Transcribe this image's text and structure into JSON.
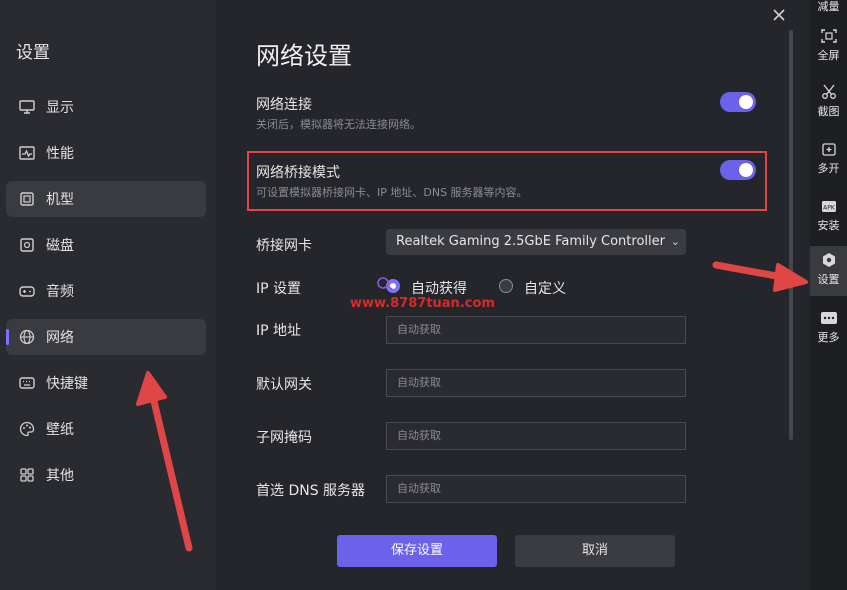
{
  "sidebar": {
    "title": "设置",
    "items": [
      {
        "label": "显示",
        "icon": "monitor-icon"
      },
      {
        "label": "性能",
        "icon": "pulse-icon"
      },
      {
        "label": "机型",
        "icon": "device-icon"
      },
      {
        "label": "磁盘",
        "icon": "disk-icon"
      },
      {
        "label": "音频",
        "icon": "gamepad-icon"
      },
      {
        "label": "网络",
        "icon": "globe-icon"
      },
      {
        "label": "快捷键",
        "icon": "keyboard-icon"
      },
      {
        "label": "壁纸",
        "icon": "palette-icon"
      },
      {
        "label": "其他",
        "icon": "grid-icon"
      }
    ]
  },
  "main": {
    "title": "网络设置",
    "network_connection": {
      "label": "网络连接",
      "desc": "关闭后，模拟器将无法连接网络。",
      "enabled": true
    },
    "bridge_mode": {
      "label": "网络桥接模式",
      "desc": "可设置模拟器桥接网卡、IP 地址、DNS 服务器等内容。",
      "enabled": true
    },
    "bridge_adapter": {
      "label": "桥接网卡",
      "value": "Realtek Gaming 2.5GbE Family Controller"
    },
    "ip_setting": {
      "label": "IP 设置",
      "option_auto": "自动获得",
      "option_custom": "自定义",
      "selected": "自动获得"
    },
    "fields": [
      {
        "label": "IP 地址",
        "placeholder": "自动获取"
      },
      {
        "label": "默认网关",
        "placeholder": "自动获取"
      },
      {
        "label": "子网掩码",
        "placeholder": "自动获取"
      },
      {
        "label": "首选 DNS 服务器",
        "placeholder": "自动获取"
      }
    ],
    "save_label": "保存设置",
    "cancel_label": "取消",
    "watermark": "www.8787tuan.com"
  },
  "rightbar": {
    "items": [
      {
        "label": "减量"
      },
      {
        "label": "全屏"
      },
      {
        "label": "截图"
      },
      {
        "label": "多开"
      },
      {
        "label": "安装"
      },
      {
        "label": "设置"
      },
      {
        "label": "更多"
      }
    ]
  },
  "colors": {
    "accent": "#6c61ea",
    "highlight": "#e04646",
    "arrow": "#e04646"
  }
}
